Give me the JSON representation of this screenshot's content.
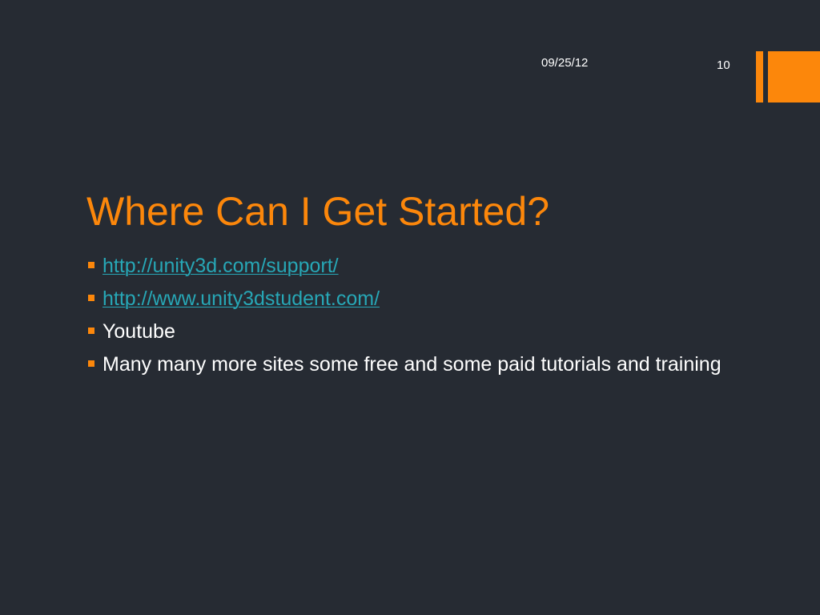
{
  "slide": {
    "date": "09/25/12",
    "page_number": "10",
    "title": "Where Can I Get Started?",
    "bullets": [
      {
        "text": "http://unity3d.com/support/",
        "is_link": true
      },
      {
        "text": "http://www.unity3dstudent.com/",
        "is_link": true
      },
      {
        "text": "Youtube",
        "is_link": false
      },
      {
        "text": "Many many more sites some free and some paid tutorials and training",
        "is_link": false
      }
    ]
  },
  "colors": {
    "background": "#262b33",
    "accent": "#fc870b",
    "link": "#27a7b6",
    "text": "#ffffff"
  }
}
